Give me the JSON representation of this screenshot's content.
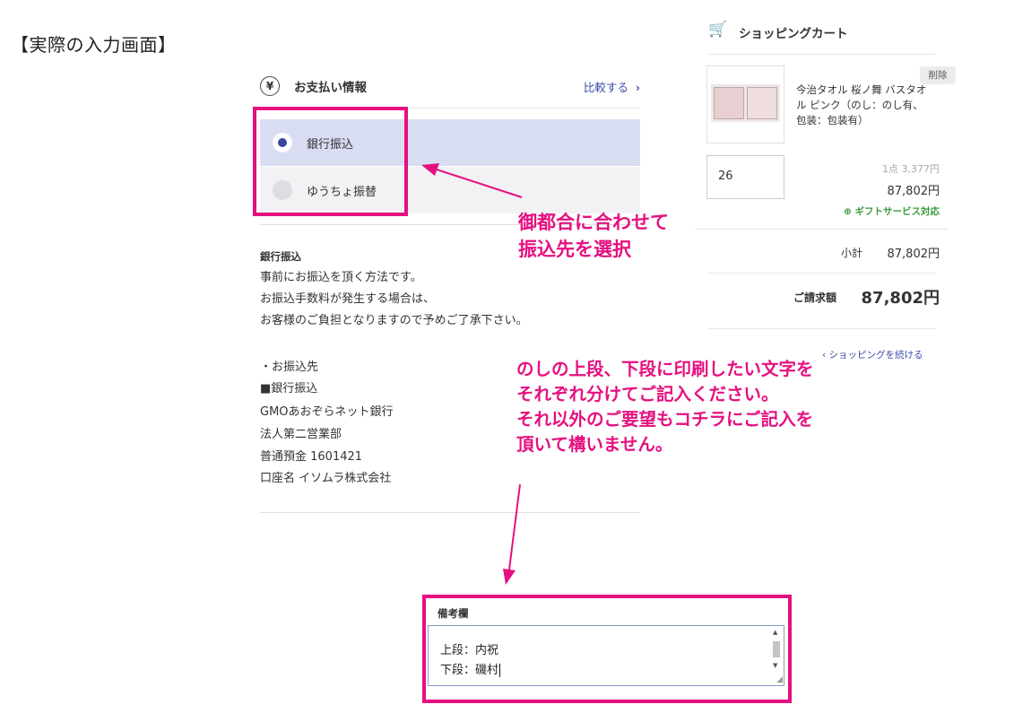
{
  "page_heading": "【実際の入力画面】",
  "payment": {
    "title": "お支払い情報",
    "compare_link": "比較する",
    "options": [
      {
        "label": "銀行振込",
        "selected": true
      },
      {
        "label": "ゆうちょ振替",
        "selected": false
      }
    ],
    "description_title": "銀行振込",
    "description_lines": [
      "事前にお振込を頂く方法です。",
      "お振込手数料が発生する場合は、",
      "お客様のご負担となりますので予めご了承下さい。"
    ],
    "account_lines": [
      "・お振込先",
      "■銀行振込",
      "GMOあおぞらネット銀行",
      "法人第二営業部",
      "普通預金 1601421",
      "口座名 イソムラ株式会社"
    ]
  },
  "annotations": {
    "select_note": [
      "御都合に合わせて",
      "振込先を選択"
    ],
    "memo_note": [
      "のしの上段、下段に印刷したい文字を",
      "それぞれ分けてご記入ください。",
      "それ以外のご要望もコチラにご記入を",
      "頂いて構いません。"
    ],
    "accent_color": "#e5107f"
  },
  "memo": {
    "label": "備考欄",
    "lines": [
      "上段：内祝",
      "下段：磯村"
    ]
  },
  "cart": {
    "title": "ショッピングカート",
    "product_name": "今治タオル 桜ノ舞 バスタオル ピンク（のし：のし有、包装：包装有）",
    "delete_label": "削除",
    "quantity": "26",
    "unit_price": "1点 3,377円",
    "line_price": "87,802円",
    "gift_label": "ギフトサービス対応",
    "subtotal_label": "小計",
    "subtotal_value": "87,802円",
    "total_label": "ご請求額",
    "total_value": "87,802円",
    "continue_link": "ショッピングを続ける"
  }
}
